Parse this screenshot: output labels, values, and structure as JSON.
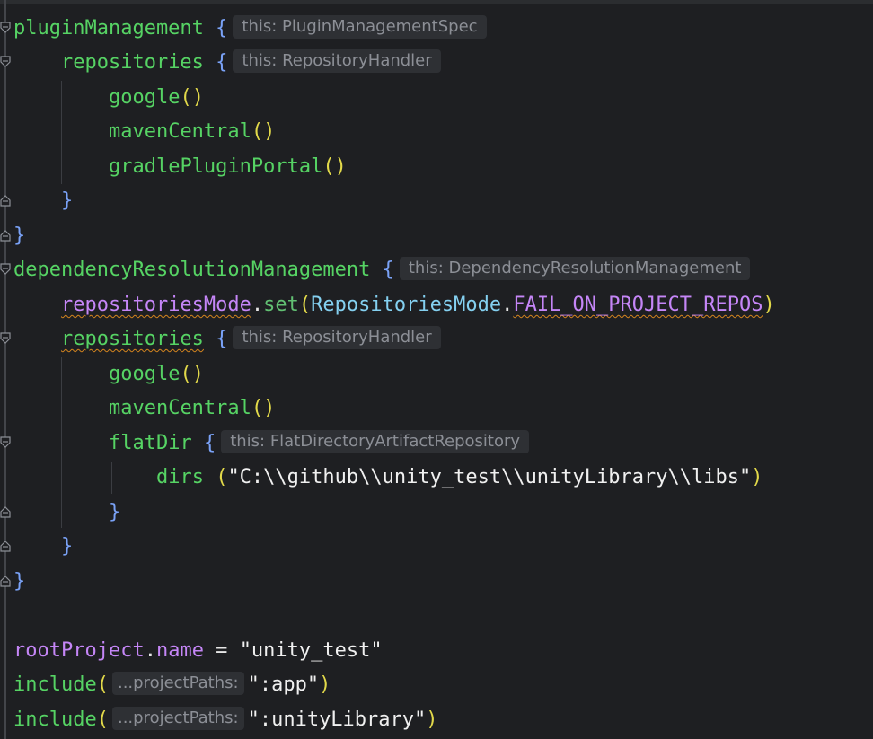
{
  "colors": {
    "background": "#1e1f22",
    "function": "#56d364",
    "property": "#c586f7",
    "brace": "#7aa2f7",
    "paren": "#e2d94a",
    "string": "#f0f0f0",
    "type": "#84d0f0",
    "hint_bg": "#2e3034",
    "hint_text": "#8c8f96",
    "warning_underline": "#d4841e"
  },
  "code": {
    "l1": {
      "fn": "pluginManagement",
      "brace": "{",
      "hint": "this: PluginManagementSpec"
    },
    "l2": {
      "fn": "repositories",
      "brace": "{",
      "hint": "this: RepositoryHandler"
    },
    "l3": {
      "fn": "google",
      "parens": "()"
    },
    "l4": {
      "fn": "mavenCentral",
      "parens": "()"
    },
    "l5": {
      "fn": "gradlePluginPortal",
      "parens": "()"
    },
    "l6": {
      "brace": "}"
    },
    "l7": {
      "brace": "}"
    },
    "l8": {
      "fn": "dependencyResolutionManagement",
      "brace": "{",
      "hint": "this: DependencyResolutionManagement"
    },
    "l9": {
      "prop": "repositoriesMode",
      "dot": ".",
      "method": "set",
      "open": "(",
      "type": "RepositoriesMode",
      "dot2": ".",
      "const": "FAIL_ON_PROJECT_REPOS",
      "close": ")"
    },
    "l10": {
      "fn": "repositories",
      "brace": "{",
      "hint": "this: RepositoryHandler"
    },
    "l11": {
      "fn": "google",
      "parens": "()"
    },
    "l12": {
      "fn": "mavenCentral",
      "parens": "()"
    },
    "l13": {
      "fn": "flatDir",
      "brace": "{",
      "hint": "this: FlatDirectoryArtifactRepository"
    },
    "l14": {
      "fn": "dirs",
      "open": "(",
      "string": "\"C:\\\\github\\\\unity_test\\\\unityLibrary\\\\libs\"",
      "close": ")"
    },
    "l15": {
      "brace": "}"
    },
    "l16": {
      "brace": "}"
    },
    "l17": {
      "brace": "}"
    },
    "l19": {
      "prop": "rootProject",
      "dot": ".",
      "name": "name",
      "eq": " = ",
      "string": "\"unity_test\""
    },
    "l20": {
      "fn": "include",
      "open": "(",
      "hint": "...projectPaths:",
      "string": "\":app\"",
      "close": ")"
    },
    "l21": {
      "fn": "include",
      "open": "(",
      "hint": "...projectPaths:",
      "string": "\":unityLibrary\"",
      "close": ")"
    }
  }
}
